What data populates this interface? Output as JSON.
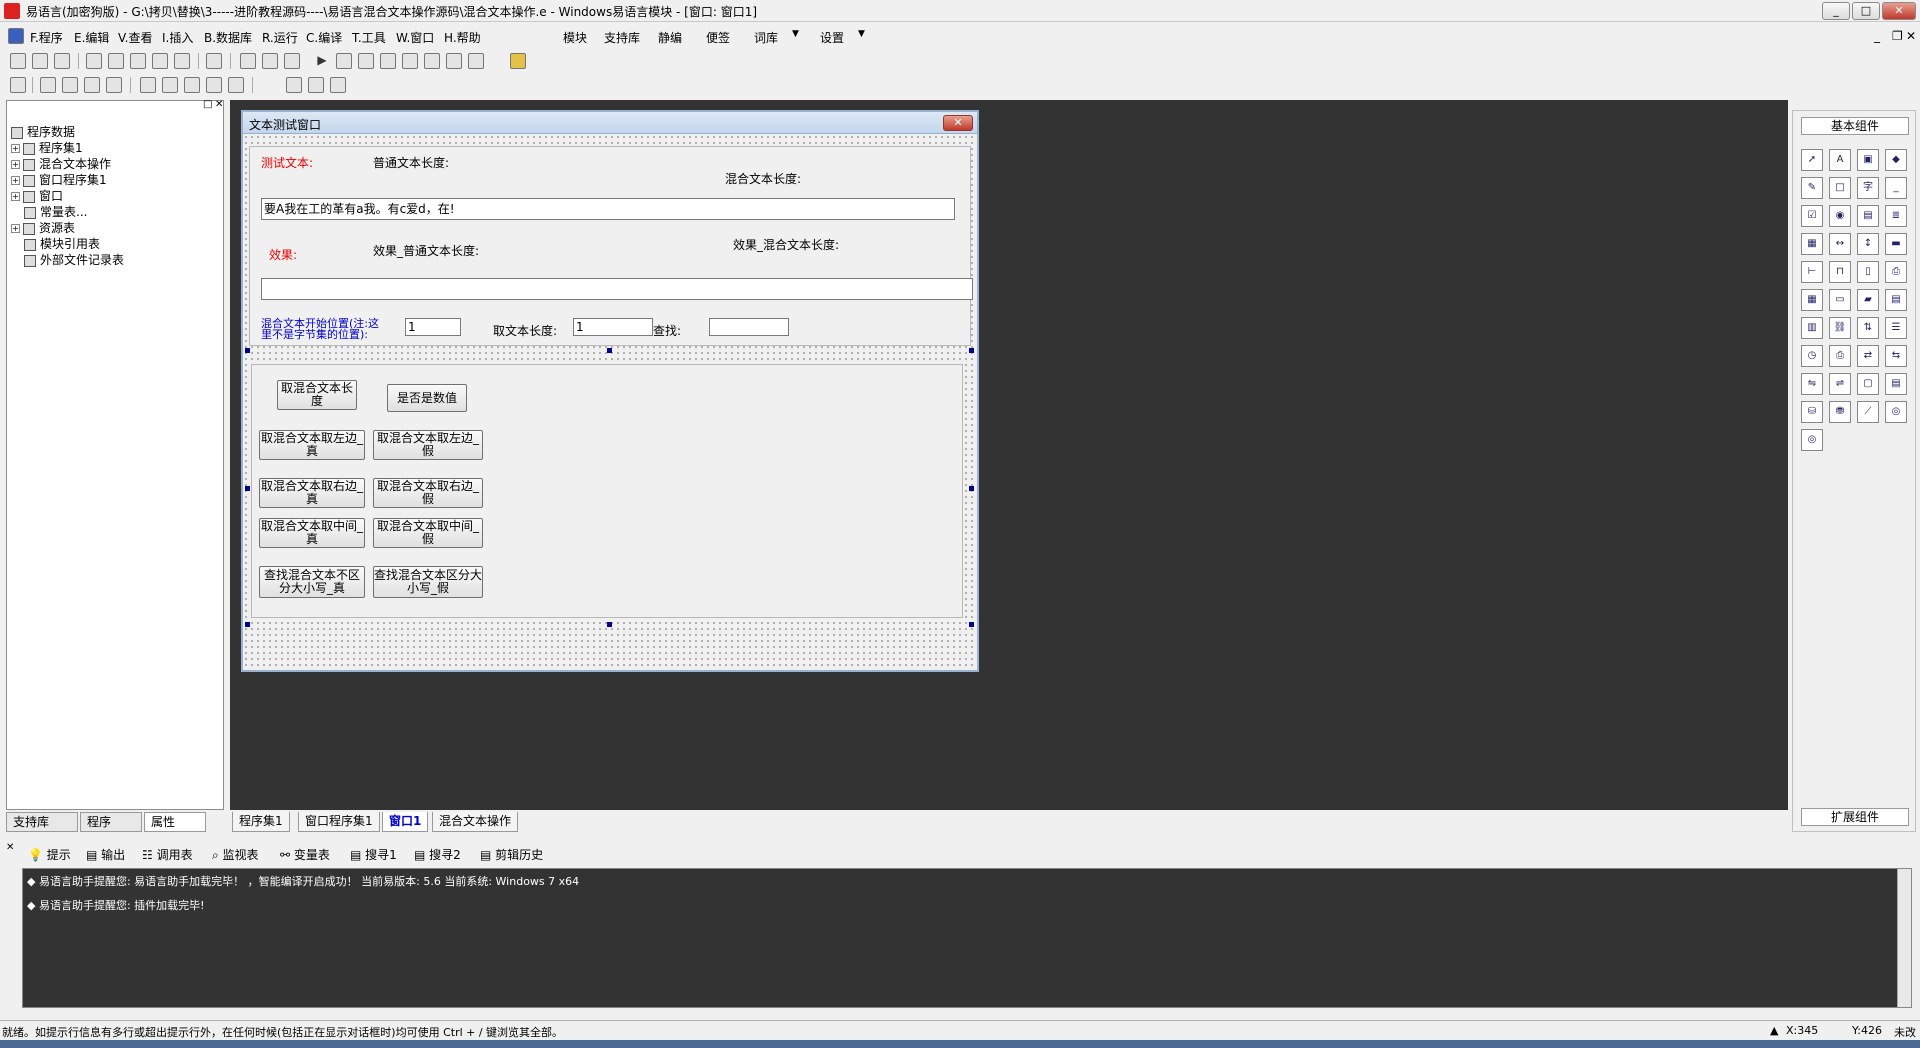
{
  "window": {
    "title": "易语言(加密狗版) - G:\\拷贝\\替换\\3-----进阶教程源码----\\易语言混合文本操作源码\\混合文本操作.e - Windows易语言模块 - [窗口: 窗口1]",
    "min": "_",
    "max": "□",
    "close": "✕"
  },
  "menubar": {
    "items": [
      "F.程序",
      "E.编辑",
      "V.查看",
      "I.插入",
      "B.数据库",
      "R.运行",
      "C.编译",
      "T.工具",
      "W.窗口",
      "H.帮助"
    ],
    "right": [
      "模块",
      "支持库",
      "静编",
      "便签",
      "词库",
      "设置"
    ],
    "mdi": [
      "_",
      "❐",
      "✕"
    ]
  },
  "tree": {
    "items": [
      "程序数据",
      "程序集1",
      "混合文本操作",
      "窗口程序集1",
      "窗口",
      "常量表...",
      "资源表",
      "模块引用表",
      "外部文件记录表"
    ]
  },
  "lefttabs": [
    "支持库",
    "程序",
    "属性"
  ],
  "design": {
    "title": "文本测试窗口",
    "lbl_test": "测试文本:",
    "lbl_normal_len": "普通文本长度:",
    "lbl_mixed_len": "混合文本长度:",
    "input_text": "要A我在工的革有a我。有c爱d，在!",
    "lbl_effect": "效果:",
    "lbl_eff_normal": "效果_普通文本长度:",
    "lbl_eff_mixed": "效果_混合文本长度:",
    "result_text": "",
    "lbl_start": "混合文本开始位置(注:这里不是字节集的位置):",
    "start_val": "1",
    "lbl_take_len": "取文本长度:",
    "take_len_val": "1",
    "lbl_find": "查找:",
    "find_val": "",
    "buttons": {
      "b1": "取混合文本长度",
      "b2": "是否是数值",
      "b3": "取混合文本取左边_真",
      "b4": "取混合文本取左边_假",
      "b5": "取混合文本取右边_真",
      "b6": "取混合文本取右边_假",
      "b7": "取混合文本取中间_真",
      "b8": "取混合文本取中间_假",
      "b9": "查找混合文本不区分大小写_真",
      "b10": "查找混合文本区分大小写_假"
    }
  },
  "rightpanel": {
    "header": "基本组件",
    "footer": "扩展组件"
  },
  "doctabs": [
    "程序集1",
    "窗口程序集1",
    "窗口1",
    "混合文本操作"
  ],
  "outtabs": [
    "提示",
    "输出",
    "调用表",
    "监视表",
    "变量表",
    "搜寻1",
    "搜寻2",
    "剪辑历史"
  ],
  "output": {
    "line1": "◆ 易语言助手提醒您: 易语言助手加载完毕！ ，智能编译开启成功！ 当前易版本: 5.6  当前系统: Windows 7 x64",
    "line2": "◆ 易语言助手提醒您: 插件加载完毕!"
  },
  "status": {
    "text": "就绪。如提示行信息有多行或超出提示行外，在任何时候(包括正在显示对话框时)均可使用 Ctrl + / 键浏览其全部。",
    "x": "X:345",
    "y": "Y:426",
    "mod": "未改"
  }
}
